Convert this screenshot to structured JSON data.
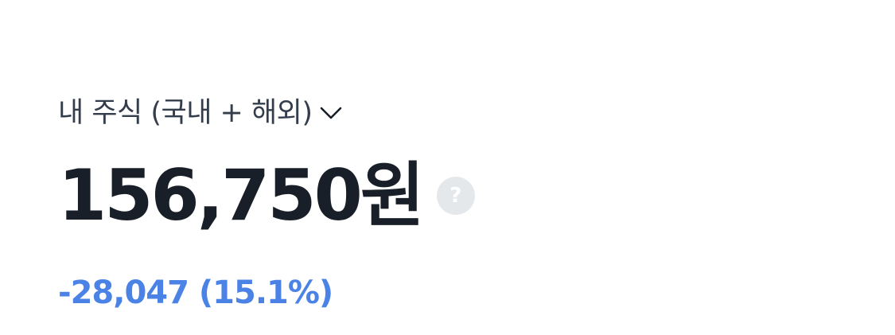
{
  "account": {
    "selector_label": "내 주식 (국내 + 해외)",
    "dropdown_icon": "chevron-down-icon"
  },
  "summary": {
    "total_value": "156,750원",
    "help_icon": "question-mark-icon",
    "help_glyph": "?",
    "change_text": "-28,047 (15.1%)"
  },
  "colors": {
    "primary_text": "#191f28",
    "secondary_text": "#333d4b",
    "loss_blue": "#4a82e5",
    "help_bg": "#e5e8eb"
  }
}
